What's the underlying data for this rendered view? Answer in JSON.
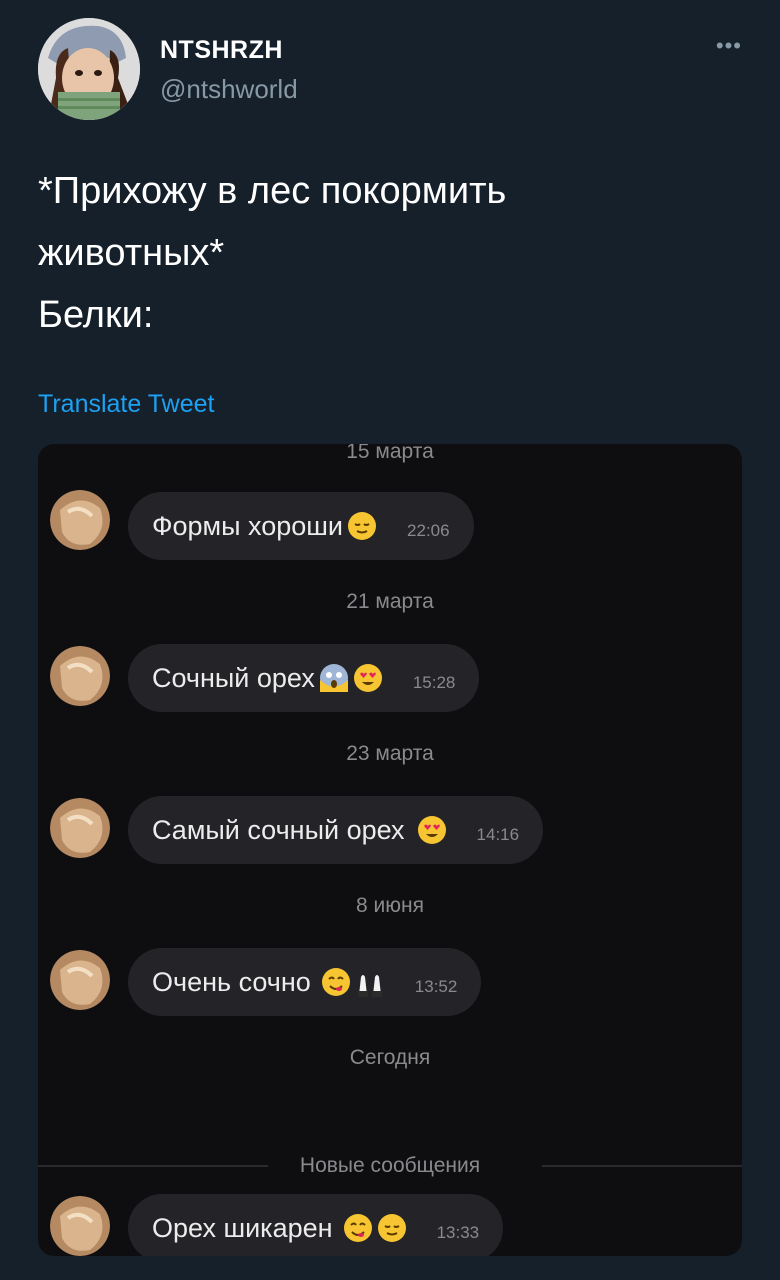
{
  "tweet": {
    "author_name": "NTSHRZH",
    "author_handle": "@ntshworld",
    "more_icon": "more-horizontal-icon",
    "text_lines": [
      "*Прихожу в лес покормить",
      "животных*",
      "Белки:"
    ],
    "translate_label": "Translate Tweet",
    "accent_color": "#1da1f2"
  },
  "chat": {
    "messages": [
      {
        "date": "15 марта",
        "text": "Формы хороши",
        "emojis": [
          "relieved-face"
        ],
        "time": "22:06"
      },
      {
        "date": "21 марта",
        "text": "Сочный орех",
        "emojis": [
          "screaming-face",
          "heart-eyes-face"
        ],
        "time": "15:28"
      },
      {
        "date": "23 марта",
        "text": "Самый сочный орех",
        "emojis": [
          "heart-eyes-face"
        ],
        "time": "14:16"
      },
      {
        "date": "8 июня",
        "text": "Очень сочно",
        "emojis": [
          "yum-face",
          "raising-hands"
        ],
        "time": "13:52"
      },
      {
        "date": "Сегодня",
        "text": "",
        "emojis": [],
        "time": ""
      }
    ],
    "new_messages_label": "Новые сообщения",
    "last_message": {
      "text": "Орех шикарен",
      "emojis": [
        "yum-face",
        "relieved-face"
      ],
      "time": "13:33"
    }
  }
}
